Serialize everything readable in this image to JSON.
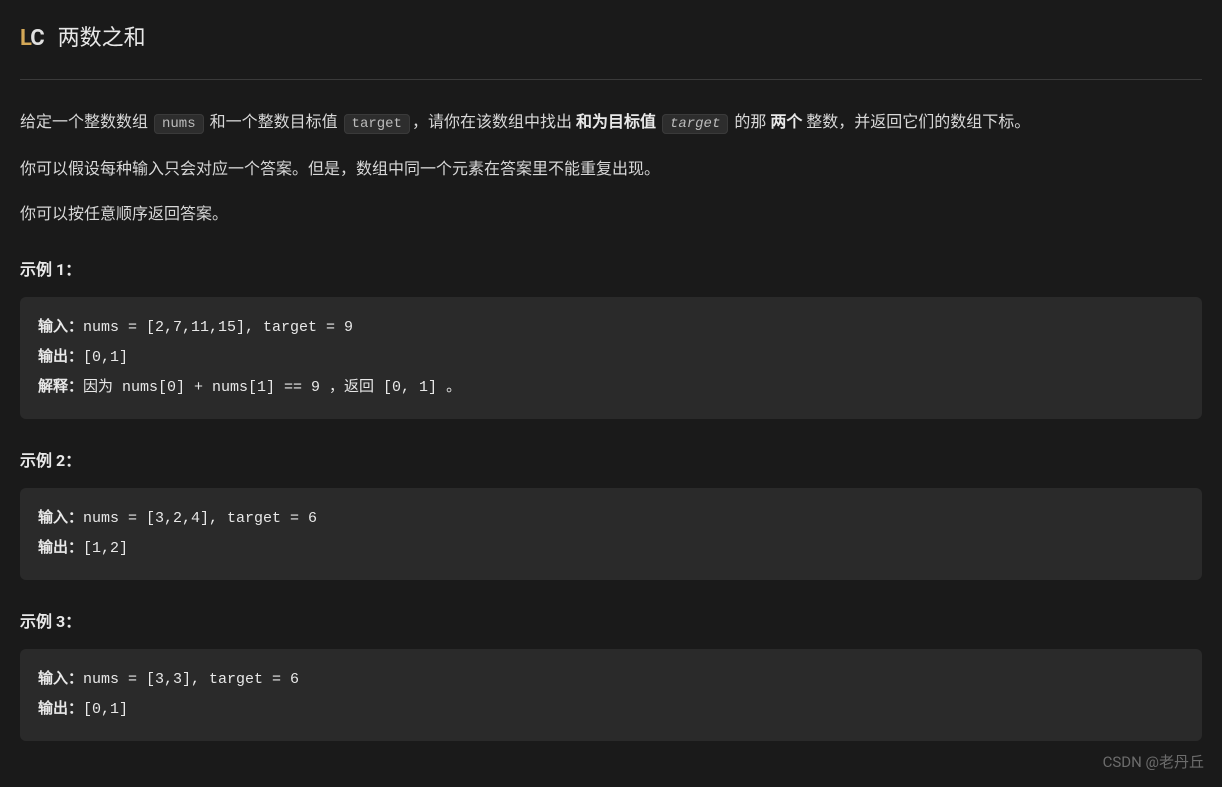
{
  "header": {
    "logo_l": "L",
    "logo_c": "C",
    "title": "两数之和"
  },
  "description": {
    "p1_a": "给定一个整数数组 ",
    "p1_code1": "nums",
    "p1_b": " 和一个整数目标值 ",
    "p1_code2": "target",
    "p1_c": "，请你在该数组中找出 ",
    "p1_bold1": "和为目标值 ",
    "p1_code3": "target",
    "p1_d": " 的那 ",
    "p1_bold2": "两个",
    "p1_e": " 整数，并返回它们的数组下标。",
    "p2": "你可以假设每种输入只会对应一个答案。但是，数组中同一个元素在答案里不能重复出现。",
    "p3": "你可以按任意顺序返回答案。"
  },
  "examples": {
    "e1_heading": "示例 1：",
    "e1_input_label": "输入：",
    "e1_input_val": "nums = [2,7,11,15], target = 9",
    "e1_output_label": "输出：",
    "e1_output_val": "[0,1]",
    "e1_explain_label": "解释：",
    "e1_explain_val": "因为 nums[0] + nums[1] == 9 ，返回 [0, 1] 。",
    "e2_heading": "示例 2：",
    "e2_input_label": "输入：",
    "e2_input_val": "nums = [3,2,4], target = 6",
    "e2_output_label": "输出：",
    "e2_output_val": "[1,2]",
    "e3_heading": "示例 3：",
    "e3_input_label": "输入：",
    "e3_input_val": "nums = [3,3], target = 6",
    "e3_output_label": "输出：",
    "e3_output_val": "[0,1]"
  },
  "watermark": "CSDN @老丹丘"
}
